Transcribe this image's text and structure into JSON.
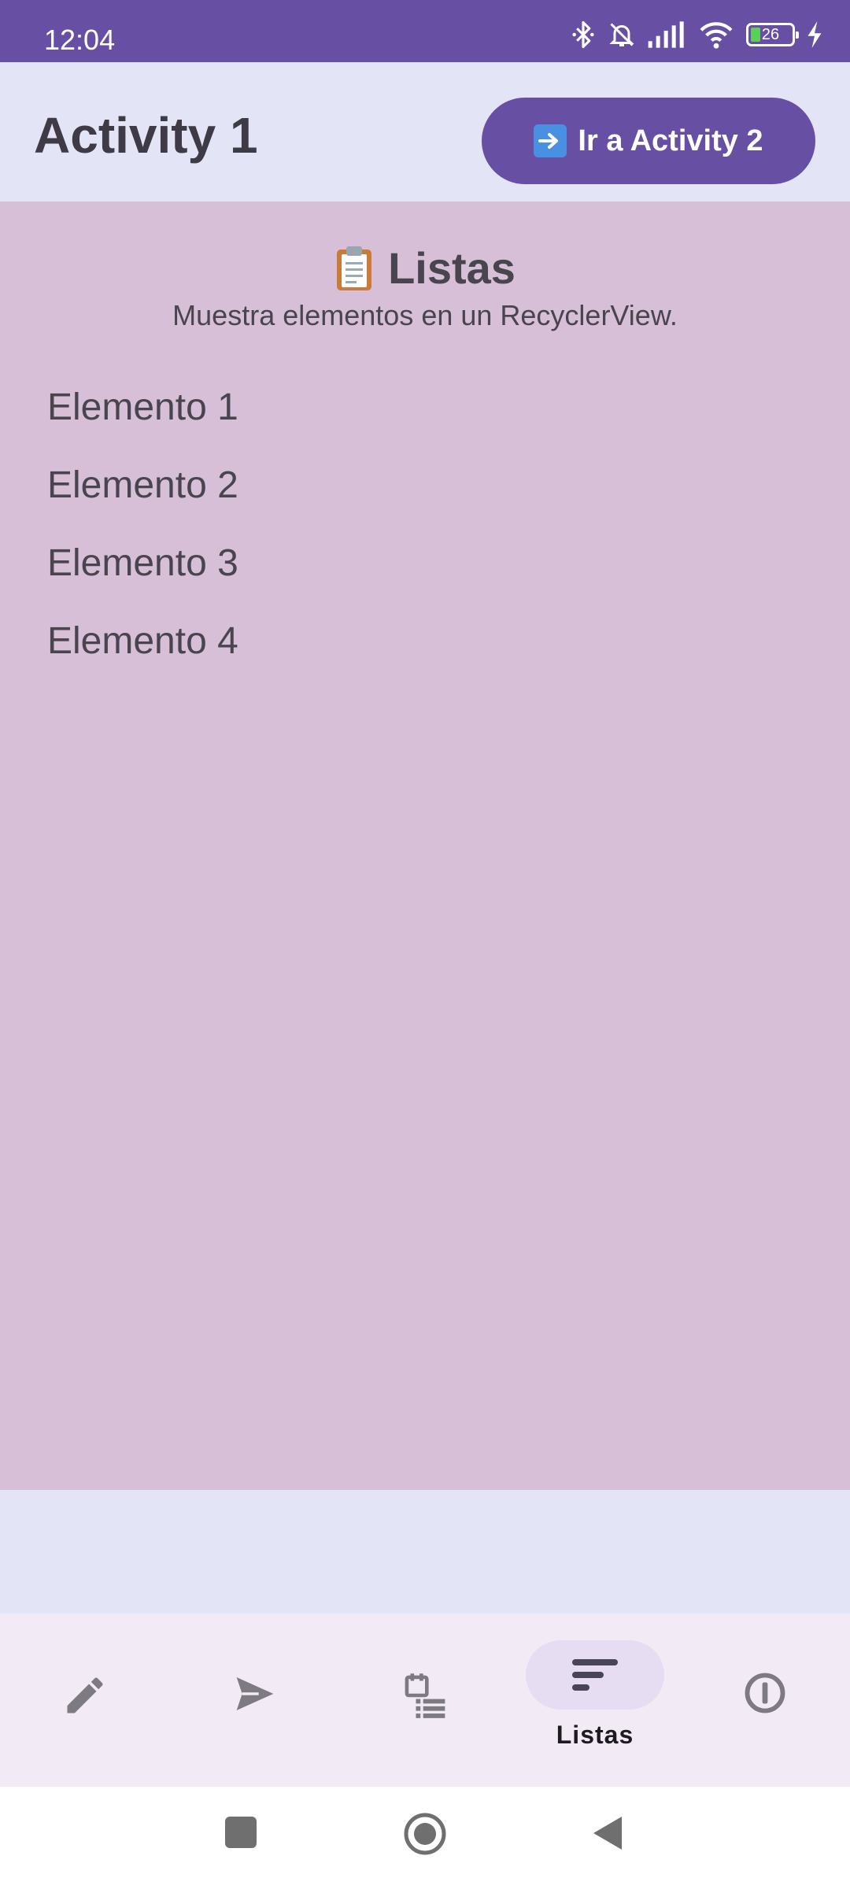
{
  "status_bar": {
    "time": "12:04",
    "battery_level": "26",
    "icons": [
      "bluetooth-icon",
      "bell-muted-icon",
      "signal-icon",
      "wifi-icon",
      "battery-icon",
      "charging-icon"
    ]
  },
  "app_bar": {
    "title": "Activity 1",
    "nav_button_label": "Ir a Activity 2",
    "nav_button_icon": "right-arrow-emoji"
  },
  "section": {
    "title": "Listas",
    "title_icon": "clipboard-emoji",
    "subtitle": "Muestra elementos en un RecyclerView."
  },
  "list": {
    "items": [
      "Elemento 1",
      "Elemento 2",
      "Elemento 3",
      "Elemento 4"
    ]
  },
  "bottom_nav": {
    "items": [
      {
        "icon": "pencil-icon",
        "label": ""
      },
      {
        "icon": "send-icon",
        "label": ""
      },
      {
        "icon": "calendar-list-icon",
        "label": ""
      },
      {
        "icon": "sort-icon",
        "label": "Listas",
        "active": true
      },
      {
        "icon": "info-icon",
        "label": ""
      }
    ]
  },
  "colors": {
    "primary": "#6750a4",
    "app_background": "#e3e4f6",
    "content_background": "#d7bfd7",
    "bottom_nav_background": "#f2ebf6",
    "active_indicator": "#e6ddf3",
    "text": "#49454f"
  },
  "system_nav": {
    "buttons": [
      "recents-square-icon",
      "home-circle-icon",
      "back-triangle-icon"
    ]
  }
}
